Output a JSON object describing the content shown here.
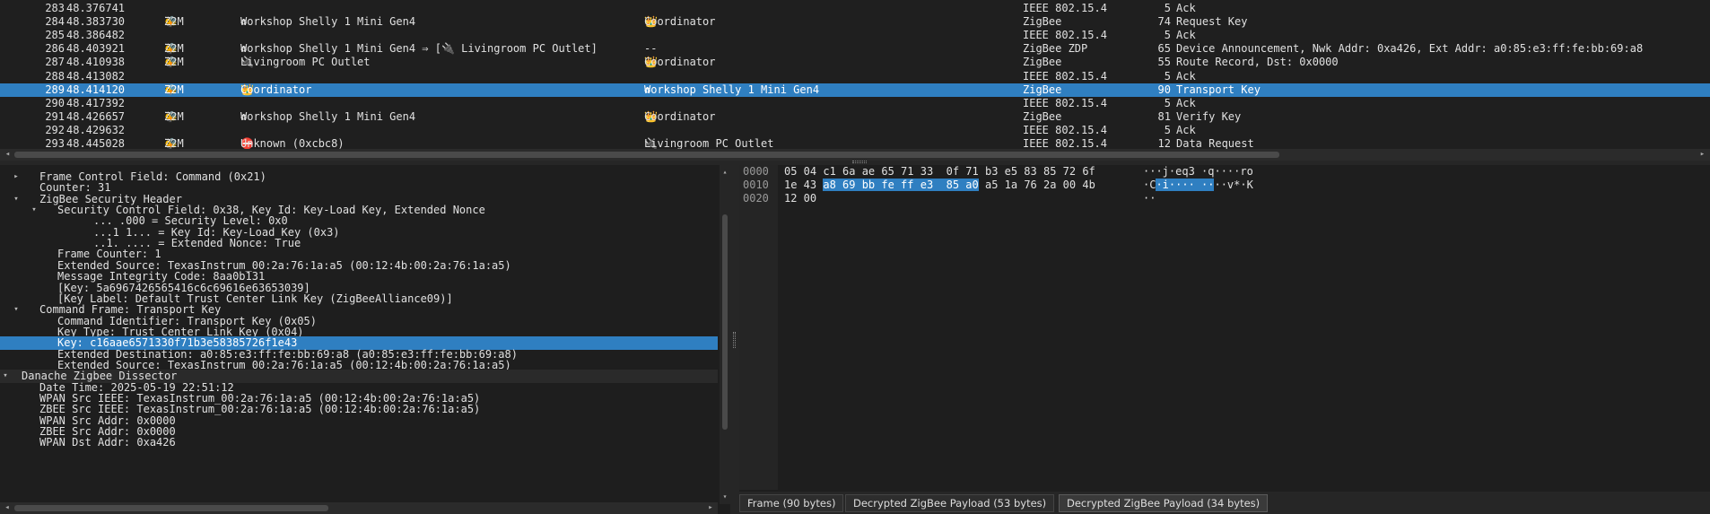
{
  "packet_list": {
    "rows": [
      {
        "no": "283",
        "time": "48.376741",
        "src": "",
        "src_device": "",
        "dst": "",
        "protocol": "IEEE 802.15.4",
        "length": "5",
        "info": "Ack"
      },
      {
        "no": "284",
        "time": "48.383730",
        "src": "Z2M",
        "src_device": "Workshop Shelly 1 Mini Gen4",
        "dst": "Coordinator",
        "protocol": "ZigBee",
        "length": "74",
        "info": "Request Key"
      },
      {
        "no": "285",
        "time": "48.386482",
        "src": "",
        "src_device": "",
        "dst": "",
        "protocol": "IEEE 802.15.4",
        "length": "5",
        "info": "Ack"
      },
      {
        "no": "286",
        "time": "48.403921",
        "src": "Z2M",
        "src_device": "Workshop Shelly 1 Mini Gen4 ⇒ [🔌 Livingroom PC Outlet]",
        "dst": "--",
        "protocol": "ZigBee ZDP",
        "length": "65",
        "info": "Device Announcement, Nwk Addr: 0xa426, Ext Addr: a0:85:e3:ff:fe:bb:69:a8"
      },
      {
        "no": "287",
        "time": "48.410938",
        "src": "Z2M",
        "src_device": "Livingroom PC Outlet",
        "dst": "Coordinator",
        "protocol": "ZigBee",
        "length": "55",
        "info": "Route Record, Dst: 0x0000"
      },
      {
        "no": "288",
        "time": "48.413082",
        "src": "",
        "src_device": "",
        "dst": "",
        "protocol": "IEEE 802.15.4",
        "length": "5",
        "info": "Ack"
      },
      {
        "no": "289",
        "time": "48.414120",
        "src": "Z2M",
        "src_device": "Coordinator",
        "dst": "Workshop Shelly 1 Mini Gen4",
        "protocol": "ZigBee",
        "length": "90",
        "info": "Transport Key"
      },
      {
        "no": "290",
        "time": "48.417392",
        "src": "",
        "src_device": "",
        "dst": "",
        "protocol": "IEEE 802.15.4",
        "length": "5",
        "info": "Ack"
      },
      {
        "no": "291",
        "time": "48.426657",
        "src": "Z2M",
        "src_device": "Workshop Shelly 1 Mini Gen4",
        "dst": "Coordinator",
        "protocol": "ZigBee",
        "length": "81",
        "info": "Verify Key"
      },
      {
        "no": "292",
        "time": "48.429632",
        "src": "",
        "src_device": "",
        "dst": "",
        "protocol": "IEEE 802.15.4",
        "length": "5",
        "info": "Ack"
      },
      {
        "no": "293",
        "time": "48.445028",
        "src": "Z2M",
        "src_device": "Unknown (0xcbc8)",
        "dst": "Livingroom PC Outlet",
        "protocol": "IEEE 802.15.4",
        "length": "12",
        "info": "Data Request"
      }
    ],
    "selected_index": 6
  },
  "icons": {
    "src_icon": "🐝",
    "device_icon": "♻",
    "plug_icon": "🔌",
    "crown_icon": "👑",
    "unknown_icon": "⛔"
  },
  "details": {
    "rows": [
      {
        "indent": 1,
        "arrow": "▸",
        "text": "Frame Control Field: Command (0x21)"
      },
      {
        "indent": 1,
        "arrow": "",
        "text": "Counter: 31"
      },
      {
        "indent": 1,
        "arrow": "▾",
        "text": "ZigBee Security Header"
      },
      {
        "indent": 2,
        "arrow": "▾",
        "text": "Security Control Field: 0x38, Key Id: Key-Load Key, Extended Nonce"
      },
      {
        "indent": 3,
        "arrow": "",
        "text": "...  .000 = Security Level: 0x0"
      },
      {
        "indent": 3,
        "arrow": "",
        "text": "...1 1... = Key Id: Key-Load Key (0x3)"
      },
      {
        "indent": 3,
        "arrow": "",
        "text": "..1. .... = Extended Nonce: True"
      },
      {
        "indent": 2,
        "arrow": "",
        "text": "Frame Counter: 1"
      },
      {
        "indent": 2,
        "arrow": "",
        "text": "Extended Source: TexasInstrum_00:2a:76:1a:a5 (00:12:4b:00:2a:76:1a:a5)"
      },
      {
        "indent": 2,
        "arrow": "",
        "text": "Message Integrity Code: 8aa0b131"
      },
      {
        "indent": 2,
        "arrow": "",
        "text": "[Key: 5a6967426565416c6c69616e63653039]"
      },
      {
        "indent": 2,
        "arrow": "",
        "text": "[Key Label: Default Trust Center Link Key (ZigBeeAlliance09)]"
      },
      {
        "indent": 1,
        "arrow": "▾",
        "text": "Command Frame: Transport Key"
      },
      {
        "indent": 2,
        "arrow": "",
        "text": "Command Identifier: Transport Key (0x05)"
      },
      {
        "indent": 2,
        "arrow": "",
        "text": "Key Type: Trust Center Link Key (0x04)"
      },
      {
        "indent": 2,
        "arrow": "",
        "text": "Key: c16aae6571330f71b3e58385726f1e43"
      },
      {
        "indent": 2,
        "arrow": "",
        "text": "Extended Destination: a0:85:e3:ff:fe:bb:69:a8 (a0:85:e3:ff:fe:bb:69:a8)"
      },
      {
        "indent": 2,
        "arrow": "",
        "text": "Extended Source: TexasInstrum_00:2a:76:1a:a5 (00:12:4b:00:2a:76:1a:a5)"
      },
      {
        "indent": 0,
        "arrow": "▾",
        "text": "Danache Zigbee Dissector"
      },
      {
        "indent": 1,
        "arrow": "",
        "text": "Date Time: 2025-05-19 22:51:12"
      },
      {
        "indent": 1,
        "arrow": "",
        "text": "WPAN Src IEEE: TexasInstrum_00:2a:76:1a:a5 (00:12:4b:00:2a:76:1a:a5)"
      },
      {
        "indent": 1,
        "arrow": "",
        "text": "ZBEE Src IEEE: TexasInstrum_00:2a:76:1a:a5 (00:12:4b:00:2a:76:1a:a5)"
      },
      {
        "indent": 1,
        "arrow": "",
        "text": "WPAN Src Addr: 0x0000"
      },
      {
        "indent": 1,
        "arrow": "",
        "text": "ZBEE Src Addr: 0x0000"
      },
      {
        "indent": 1,
        "arrow": "",
        "text": "WPAN Dst Addr: 0xa426"
      }
    ],
    "selected_index": 15,
    "header_index": 18
  },
  "bytes": {
    "rows": [
      {
        "offset": "0000",
        "hex_a": "05 04 c1 6a ae 65 71 33  0f 71 b3 e5 83 85 72 6f",
        "hex_hl": "",
        "hex_b": "",
        "ascii_a": "···j·eq3 ·q····ro",
        "ascii_hl": "",
        "ascii_b": ""
      },
      {
        "offset": "0010",
        "hex_a": "1e 43 ",
        "hex_hl": "a8 69 bb fe ff e3  85 a0",
        "hex_b": " a5 1a 76 2a 00 4b",
        "ascii_a": "·C",
        "ascii_hl": "·i···· ··",
        "ascii_b": "··v*·K"
      },
      {
        "offset": "0020",
        "hex_a": "12 00",
        "hex_hl": "",
        "hex_b": "",
        "ascii_a": "··",
        "ascii_hl": "",
        "ascii_b": ""
      }
    ]
  },
  "tabs": [
    {
      "label": "Frame (90 bytes)",
      "active": false
    },
    {
      "label": "Decrypted ZigBee Payload (53 bytes)",
      "active": false
    },
    {
      "label": "Decrypted ZigBee Payload (34 bytes)",
      "active": true
    }
  ],
  "scroll": {
    "left_arrow": "◂",
    "right_arrow": "▸",
    "up_arrow": "▴",
    "down_arrow": "▾"
  }
}
